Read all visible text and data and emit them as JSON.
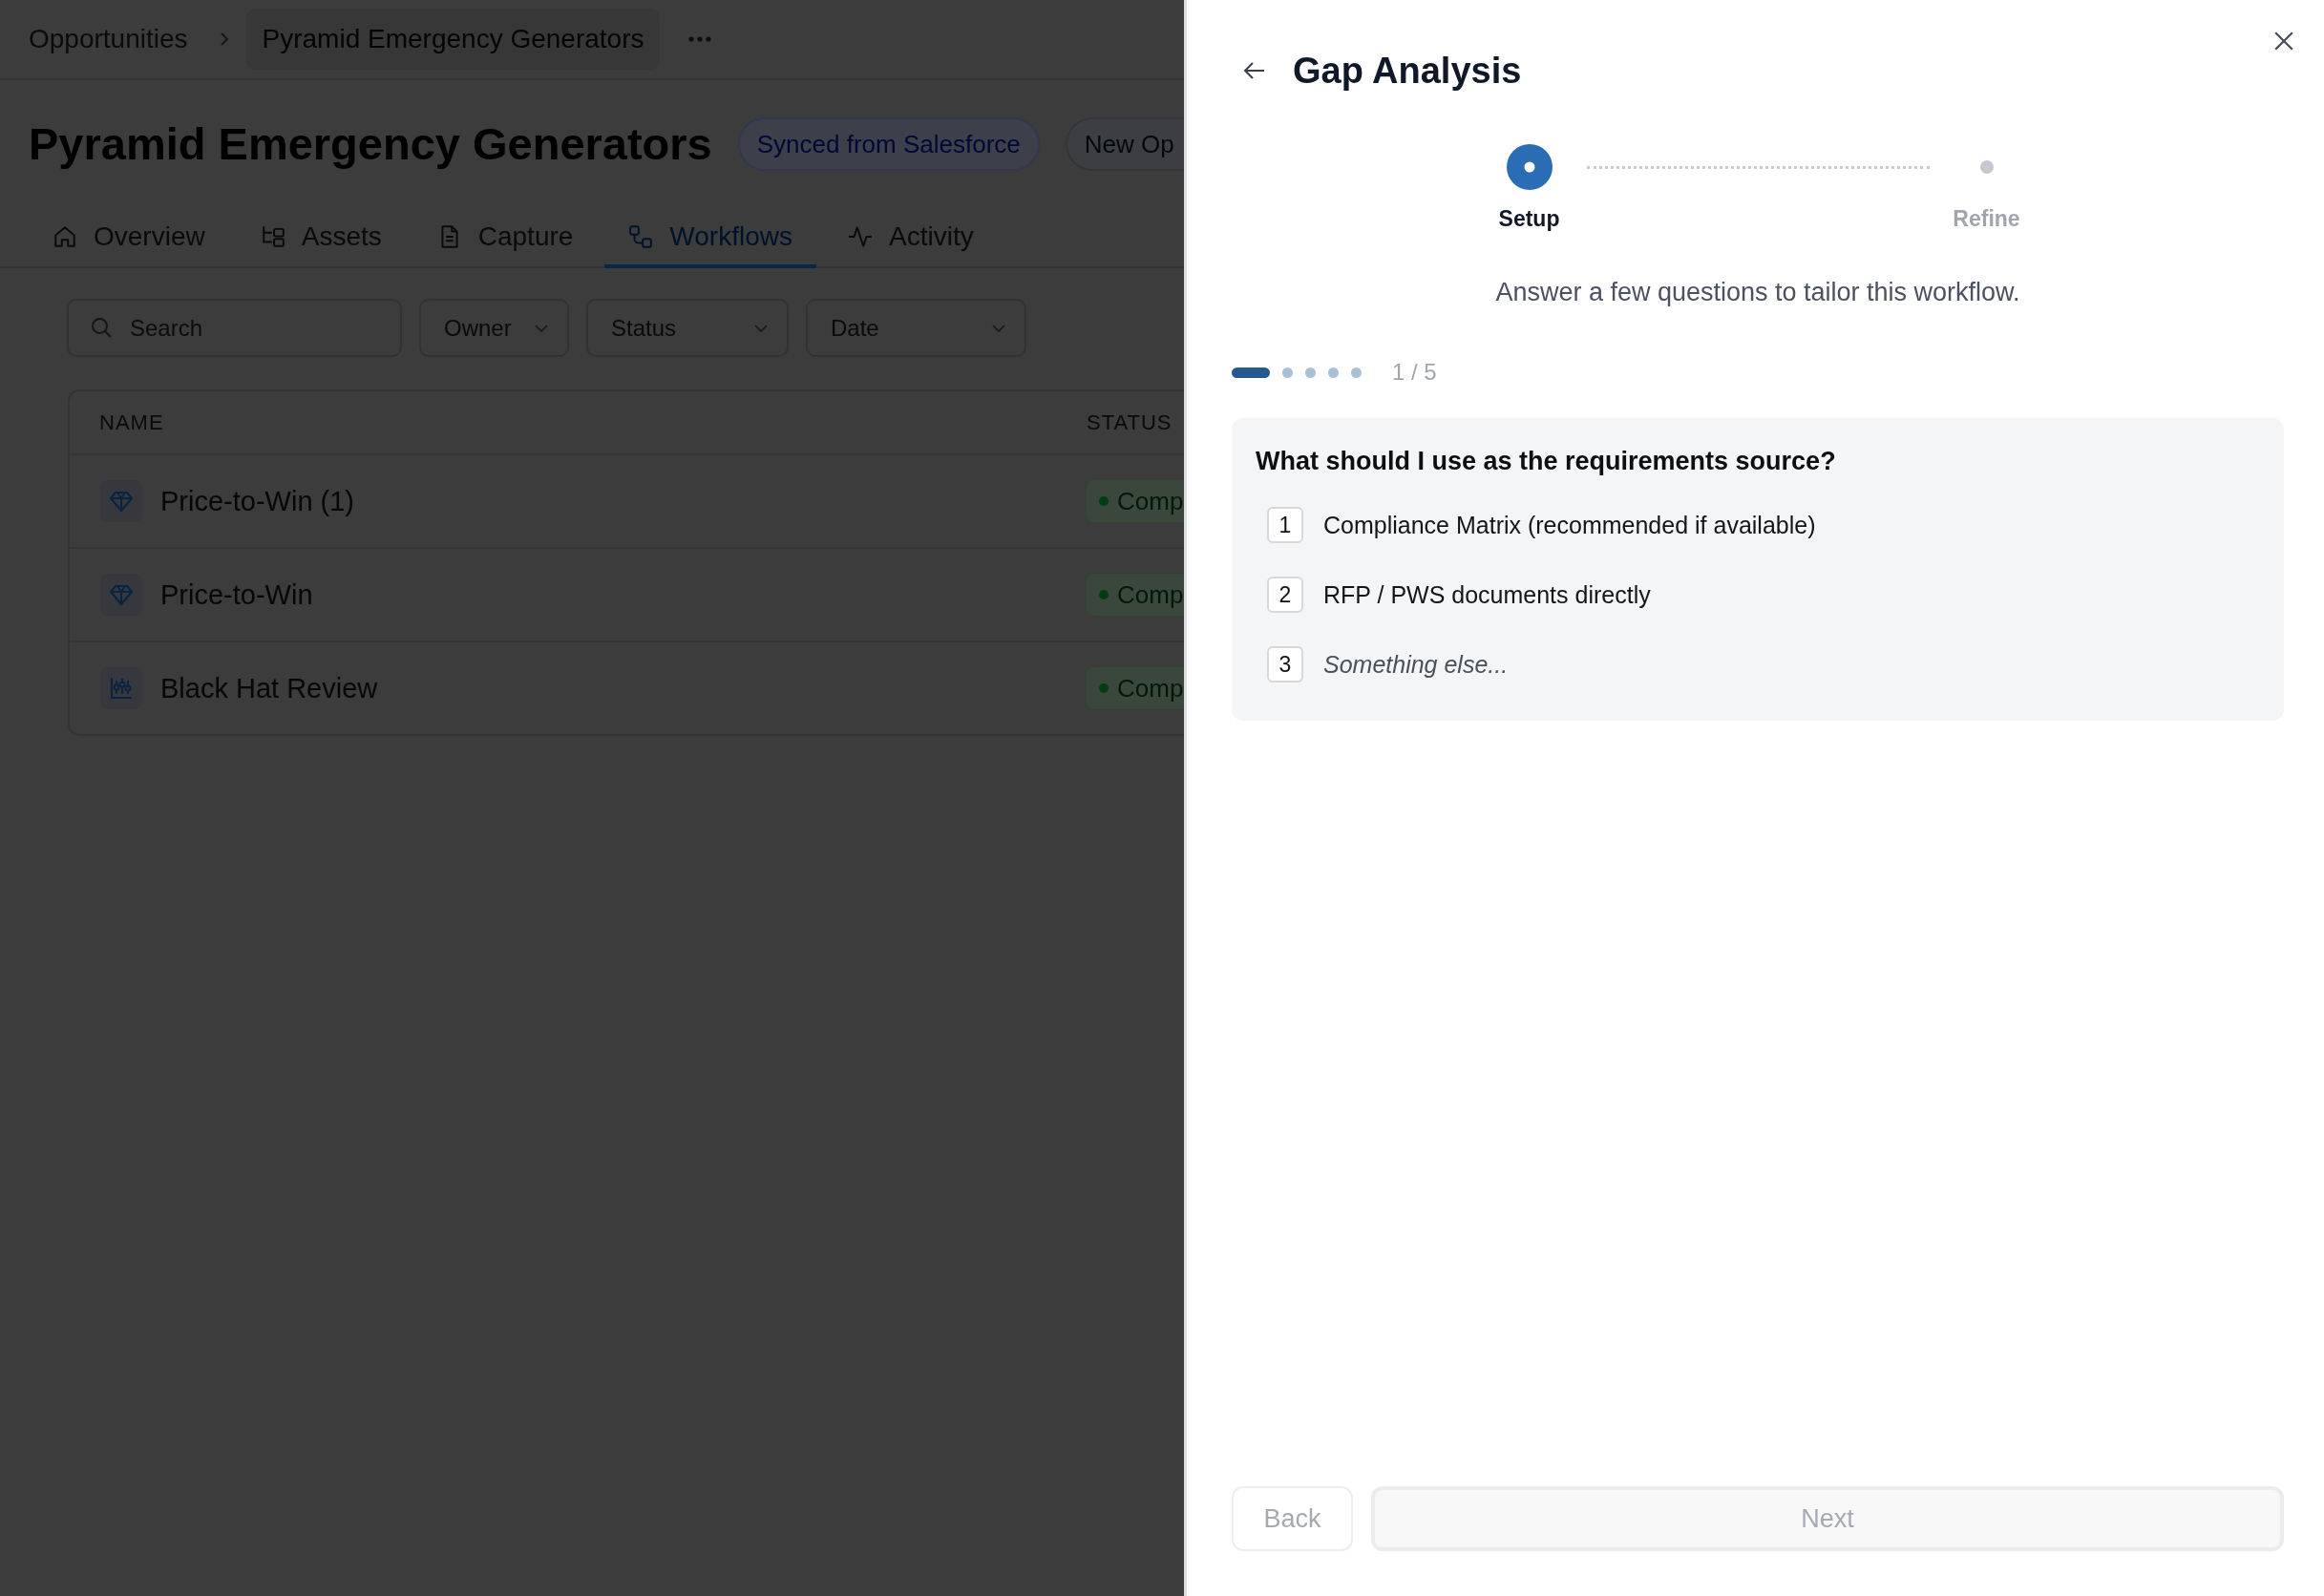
{
  "breadcrumb": [
    "Opportunities",
    "Pyramid Emergency Generators"
  ],
  "page": {
    "title": "Pyramid Emergency Generators",
    "tags": [
      {
        "label": "Synced from Salesforce",
        "kind": "info"
      },
      {
        "label": "New Op",
        "kind": "neutral"
      }
    ]
  },
  "tabs": [
    {
      "label": "Overview",
      "selected": false
    },
    {
      "label": "Assets",
      "selected": false
    },
    {
      "label": "Capture",
      "selected": false
    },
    {
      "label": "Workflows",
      "selected": true
    },
    {
      "label": "Activity",
      "selected": false
    }
  ],
  "filters": {
    "search": {
      "placeholder": "Search"
    },
    "dropdowns": [
      "Owner",
      "Status",
      "Date"
    ]
  },
  "table": {
    "columns": [
      "NAME",
      "STATUS"
    ],
    "rows": [
      {
        "name": "Price-to-Win (1)",
        "status": "Comp"
      },
      {
        "name": "Price-to-Win",
        "status": "Comp"
      },
      {
        "name": "Black Hat Review",
        "status": "Comp"
      }
    ]
  },
  "panel": {
    "title": "Gap Analysis",
    "steps": [
      {
        "label": "Setup",
        "selected": true
      },
      {
        "label": "Refine",
        "selected": false
      }
    ],
    "intro": "Answer a few questions to tailor this workflow.",
    "progress": {
      "dots": [
        {
          "selected": true
        },
        {
          "selected": false
        },
        {
          "selected": false
        },
        {
          "selected": false
        },
        {
          "selected": false
        }
      ],
      "counter": "1 / 5"
    },
    "question": {
      "text": "What should I use as the requirements source?",
      "options": [
        {
          "number": "1",
          "label": "Compliance Matrix (recommended if available)",
          "kind": "choice",
          "selected": false
        },
        {
          "number": "2",
          "label": "RFP / PWS documents directly",
          "kind": "choice",
          "selected": false
        },
        {
          "number": "3",
          "label": "Something else...",
          "kind": "other",
          "selected": false
        }
      ]
    },
    "buttons": [
      {
        "label": "Back",
        "kind": "secondary",
        "disabled": true
      },
      {
        "label": "Next",
        "kind": "primary",
        "disabled": true
      }
    ]
  }
}
